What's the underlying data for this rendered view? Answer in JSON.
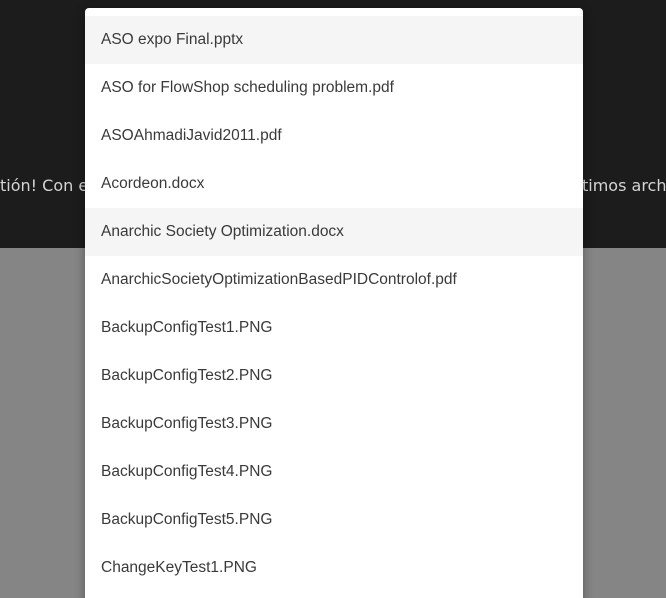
{
  "background": {
    "banner_left": "tión! Con es",
    "banner_right": "timos archiv"
  },
  "dropdown": {
    "items": [
      {
        "label": "ASO expo Final.pptx",
        "highlighted": true
      },
      {
        "label": "ASO for FlowShop scheduling problem.pdf",
        "highlighted": false
      },
      {
        "label": "ASOAhmadiJavid2011.pdf",
        "highlighted": false
      },
      {
        "label": "Acordeon.docx",
        "highlighted": false
      },
      {
        "label": "Anarchic Society Optimization.docx",
        "highlighted": true
      },
      {
        "label": "AnarchicSocietyOptimizationBasedPIDControlof.pdf",
        "highlighted": false
      },
      {
        "label": "BackupConfigTest1.PNG",
        "highlighted": false
      },
      {
        "label": "BackupConfigTest2.PNG",
        "highlighted": false
      },
      {
        "label": "BackupConfigTest3.PNG",
        "highlighted": false
      },
      {
        "label": "BackupConfigTest4.PNG",
        "highlighted": false
      },
      {
        "label": "BackupConfigTest5.PNG",
        "highlighted": false
      },
      {
        "label": "ChangeKeyTest1.PNG",
        "highlighted": false
      }
    ]
  }
}
